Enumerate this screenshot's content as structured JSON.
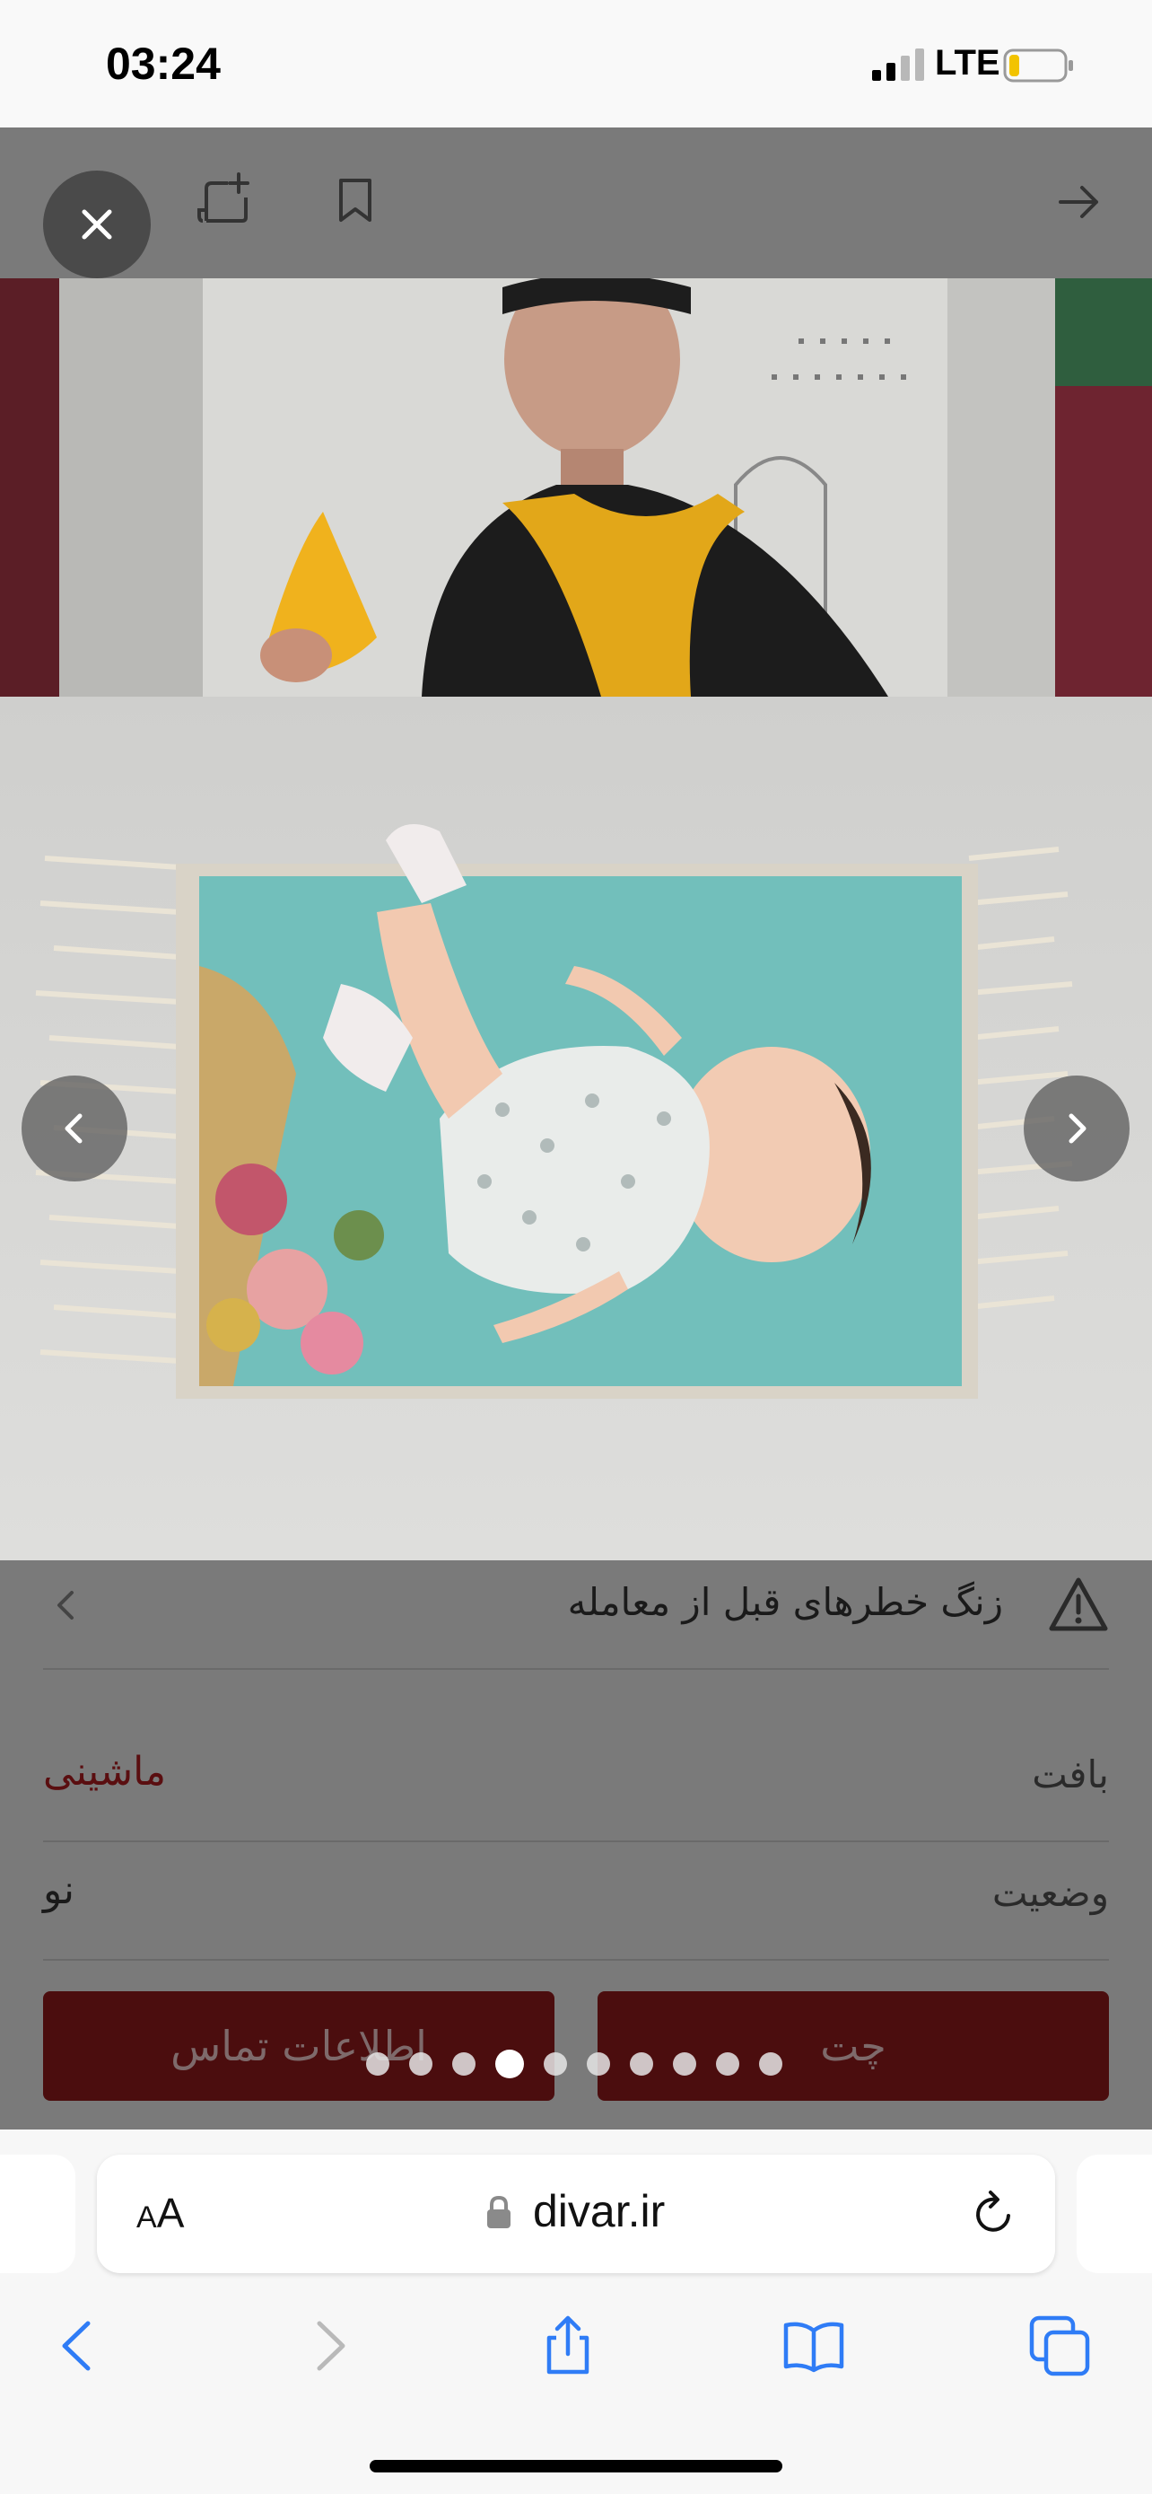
{
  "status_bar": {
    "time": "03:24",
    "network": "LTE"
  },
  "gallery": {
    "toolbar_icons": [
      "close-icon",
      "add-note-icon",
      "bookmark-icon",
      "forward-arrow-icon"
    ],
    "current_index": 4,
    "total": 10
  },
  "details": {
    "warning_text": "زنگ خطرهای قبل از معامله",
    "attributes": [
      {
        "label": "بافت",
        "value": "ماشینی"
      },
      {
        "label": "وضعیت",
        "value": "نو"
      }
    ]
  },
  "actions": {
    "contact": "اطلاعات تماس",
    "chat": "چت"
  },
  "browser": {
    "aa_small": "A",
    "aa_large": "A",
    "url": "divar.ir"
  },
  "colors": {
    "accent": "#4b0d0e",
    "attribute_value": "#5a0e10",
    "link_blue": "#2f7cf6"
  }
}
